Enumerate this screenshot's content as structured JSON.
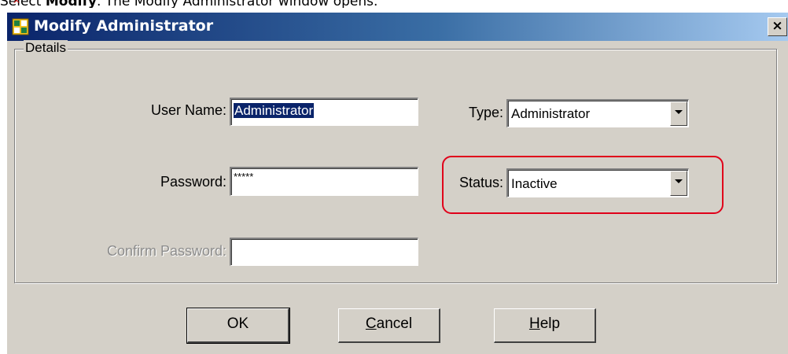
{
  "caption": {
    "prefix": "Select ",
    "bold": "Modify",
    "suffix": ". The Modify Administrator window opens."
  },
  "window": {
    "title": "Modify Administrator",
    "close_glyph": "×"
  },
  "details": {
    "group_label": "Details",
    "user_name": {
      "label": "User Name:",
      "value": "Administrator"
    },
    "password": {
      "label": "Password:",
      "value": "*****"
    },
    "confirm_password": {
      "label": "Confirm Password:",
      "value": ""
    },
    "type": {
      "label": "Type:",
      "value": "Administrator"
    },
    "status": {
      "label": "Status:",
      "value": "Inactive"
    }
  },
  "buttons": {
    "ok": "OK",
    "cancel_rest": "ancel",
    "cancel_mnemonic": "C",
    "help_rest": "elp",
    "help_mnemonic": "H"
  },
  "colors": {
    "highlight": "#e0001a",
    "titlebar": "#0a246a",
    "selection": "#0a246a"
  },
  "icons": {
    "title": "app-window-icon",
    "dropdown": "chevron-down-icon"
  }
}
